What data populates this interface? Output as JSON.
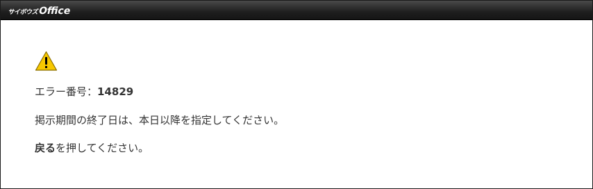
{
  "header": {
    "logo_kana": "サイボウズ",
    "logo_word": "Office"
  },
  "error": {
    "icon": "warning-icon",
    "code_label": "エラー番号：",
    "code_value": "14829",
    "message": "掲示期間の終了日は、本日以降を指定してください。",
    "back_link": "戻る",
    "back_suffix": "を押してください。"
  },
  "colors": {
    "header_bg": "#1e1e1e",
    "icon_fill": "#f7c800",
    "text": "#333333"
  }
}
